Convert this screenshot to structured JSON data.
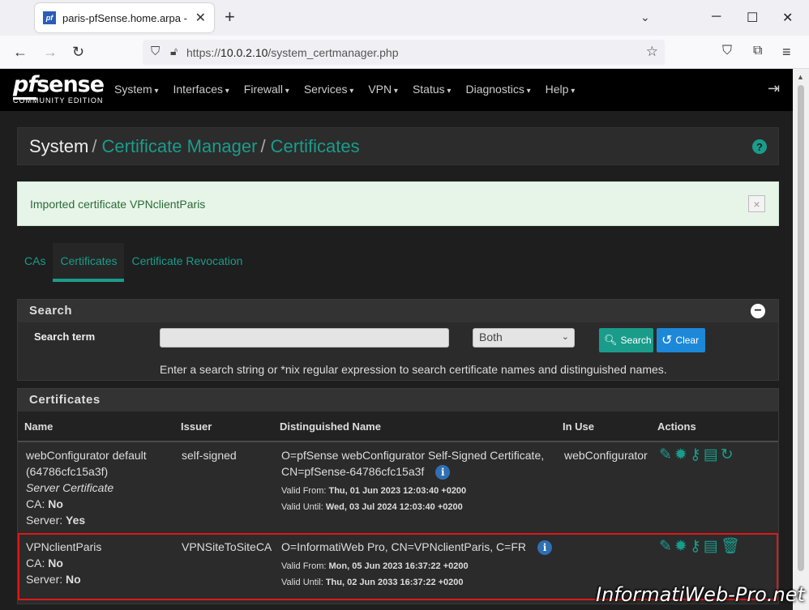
{
  "browser": {
    "tab_title": "paris-pfSense.home.arpa - Syst",
    "favicon_text": "pf",
    "url_scheme": "https://",
    "url_host": "10.0.2.10",
    "url_path": "/system_certmanager.php"
  },
  "pfsense": {
    "logo_main": "sense",
    "logo_pf": "pf",
    "logo_sub": "COMMUNITY EDITION",
    "menu": [
      "System",
      "Interfaces",
      "Firewall",
      "Services",
      "VPN",
      "Status",
      "Diagnostics",
      "Help"
    ]
  },
  "breadcrumb": {
    "root": "System",
    "sep1": "/",
    "link1": "Certificate Manager",
    "sep2": "/",
    "link2": "Certificates"
  },
  "alert": {
    "text": "Imported certificate VPNclientParis",
    "close": "×"
  },
  "tabs": [
    "CAs",
    "Certificates",
    "Certificate Revocation"
  ],
  "search": {
    "title": "Search",
    "term_label": "Search term",
    "input_value": "",
    "select_value": "Both",
    "search_button": "Search",
    "clear_button": "Clear",
    "help": "Enter a search string or *nix regular expression to search certificate names and distinguished names."
  },
  "certificates": {
    "title": "Certificates",
    "columns": [
      "Name",
      "Issuer",
      "Distinguished Name",
      "In Use",
      "Actions"
    ],
    "rows": [
      {
        "name": "webConfigurator default",
        "name2": "(64786cfc15a3f)",
        "type": "Server Certificate",
        "ca_label": "CA:",
        "ca_value": "No",
        "server_label": "Server:",
        "server_value": "Yes",
        "issuer": "self-signed",
        "dn1": "O=pfSense webConfigurator Self-Signed Certificate,",
        "dn2": "CN=pfSense-64786cfc15a3f",
        "valid_from_label": "Valid From:",
        "valid_from": "Thu, 01 Jun 2023 12:03:40 +0200",
        "valid_until_label": "Valid Until:",
        "valid_until": "Wed, 03 Jul 2024 12:03:40 +0200",
        "in_use": "webConfigurator"
      },
      {
        "name": "VPNclientParis",
        "ca_label": "CA:",
        "ca_value": "No",
        "server_label": "Server:",
        "server_value": "No",
        "issuer": "VPNSiteToSiteCA",
        "dn1": "O=InformatiWeb Pro, CN=VPNclientParis, C=FR",
        "valid_from_label": "Valid From:",
        "valid_from": "Mon, 05 Jun 2023 16:37:22 +0200",
        "valid_until_label": "Valid Until:",
        "valid_until": "Thu, 02 Jun 2033 16:37:22 +0200",
        "in_use": ""
      }
    ]
  },
  "watermark": "InformatiWeb-Pro.net",
  "colors": {
    "accent": "#1a9c8b",
    "highlight": "#e01818"
  }
}
